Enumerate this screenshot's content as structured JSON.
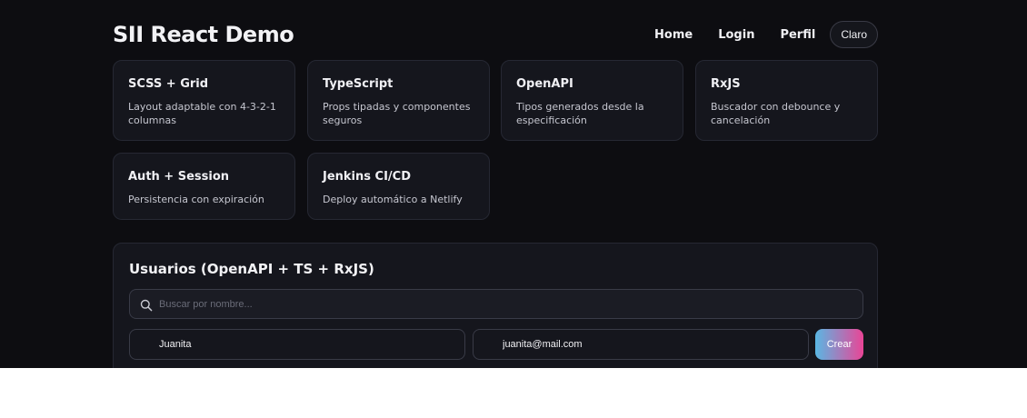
{
  "header": {
    "title": "SII React Demo",
    "nav": [
      {
        "label": "Home"
      },
      {
        "label": "Login"
      },
      {
        "label": "Perfil"
      }
    ],
    "theme_toggle_label": "Claro"
  },
  "features": [
    {
      "title": "SCSS + Grid",
      "description": "Layout adaptable con 4-3-2-1 columnas"
    },
    {
      "title": "TypeScript",
      "description": "Props tipadas y componentes seguros"
    },
    {
      "title": "OpenAPI",
      "description": "Tipos generados desde la especificación"
    },
    {
      "title": "RxJS",
      "description": "Buscador con debounce y cancelación"
    },
    {
      "title": "Auth + Session",
      "description": "Persistencia con expiración"
    },
    {
      "title": "Jenkins CI/CD",
      "description": "Deploy automático a Netlify"
    }
  ],
  "users": {
    "title": "Usuarios (OpenAPI + TS + RxJS)",
    "search": {
      "placeholder": "Buscar por nombre...",
      "value": "",
      "icon": "search-icon"
    },
    "form": {
      "name_value": "Juanita",
      "email_value": "juanita@mail.com",
      "create_label": "Crear"
    }
  },
  "colors": {
    "background": "#0d0d11",
    "card": "#15161d",
    "button_gradient_start": "#5ab7e3",
    "button_gradient_end": "#e94596"
  }
}
